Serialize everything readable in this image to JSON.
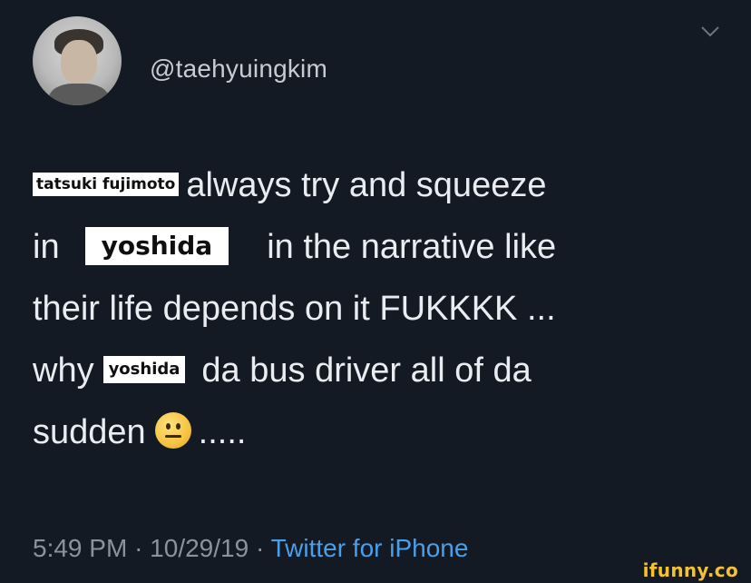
{
  "profile": {
    "handle": "@taehyuingkim",
    "avatar_icon": "avatar-photo"
  },
  "menu": {
    "icon": "chevron-down-icon"
  },
  "tweet": {
    "line1": {
      "sticker": "tatsuki fujimoto",
      "text": "always try and squeeze"
    },
    "line2": {
      "pre": "in",
      "sticker": "yoshida",
      "text": "in the narrative like"
    },
    "line3": {
      "text": "their life depends on it FUKKKK ..."
    },
    "line4": {
      "pre": "why",
      "sticker": "yoshida",
      "text": "da bus driver all of da"
    },
    "line5": {
      "pre": "sudden",
      "emoji": "neutral-face-emoji",
      "post": "....."
    }
  },
  "meta": {
    "time": "5:49 PM",
    "date": "10/29/19",
    "separator": "·",
    "source": "Twitter for iPhone"
  },
  "watermark": {
    "text": "ifunny.co"
  },
  "colors": {
    "background": "#141a23",
    "text": "#e9edf1",
    "muted": "#8a939d",
    "link": "#4a9fe8",
    "watermark": "#f2c230"
  }
}
